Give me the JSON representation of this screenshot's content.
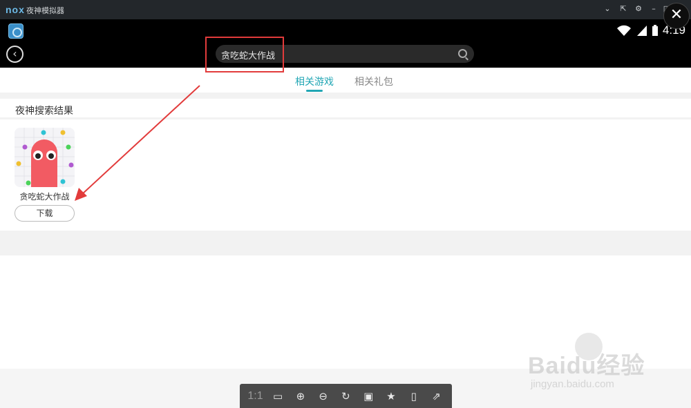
{
  "window": {
    "logo": "nox",
    "title": "夜神模拟器",
    "controls": [
      "⌄",
      "⇱",
      "⚙",
      "–",
      "□"
    ],
    "close_symbol": "✕"
  },
  "status_bar": {
    "time": "4:19",
    "icons": [
      "app-icon",
      "wifi-icon",
      "signal-icon",
      "battery-icon"
    ]
  },
  "search": {
    "query": "贪吃蛇大作战",
    "back_symbol": "‹"
  },
  "tabs": [
    {
      "label": "相关游戏",
      "active": true
    },
    {
      "label": "相关礼包",
      "active": false
    }
  ],
  "results": {
    "section_title": "夜神搜索结果",
    "items": [
      {
        "name": "贪吃蛇大作战",
        "button": "下载"
      }
    ]
  },
  "toolbar": {
    "ratio_label": "1:1",
    "buttons": [
      "fullscreen-icon",
      "zoom-in-icon",
      "zoom-out-icon",
      "rotate-icon",
      "save-icon",
      "bookmark-icon",
      "tablet-icon",
      "share-icon"
    ]
  },
  "watermark": {
    "brand": "Baidu经验",
    "url": "jingyan.baidu.com"
  },
  "colors": {
    "accent": "#21a6b4",
    "annotation": "#e23b3b"
  }
}
